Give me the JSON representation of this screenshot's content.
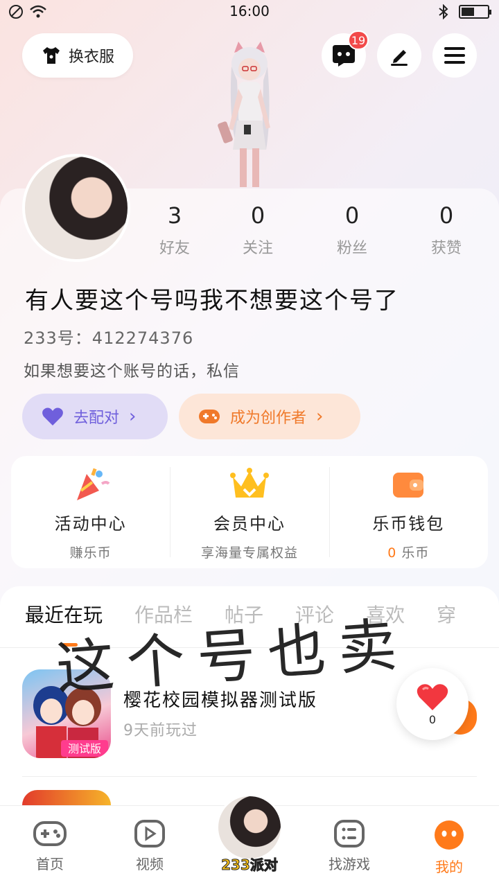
{
  "status_bar": {
    "time": "16:00"
  },
  "top": {
    "outfit_label": "换衣服",
    "message_badge": "19"
  },
  "profile": {
    "stats": [
      {
        "value": "3",
        "label": "好友"
      },
      {
        "value": "0",
        "label": "关注"
      },
      {
        "value": "0",
        "label": "粉丝"
      },
      {
        "value": "0",
        "label": "获赞"
      }
    ],
    "name": "有人要这个号吗我不想要这个号了",
    "uid": "233号：412274376",
    "bio": "如果想要这个账号的话，私信",
    "pair_button": "去配对",
    "creator_button": "成为创作者"
  },
  "services": [
    {
      "title": "活动中心",
      "subtitle": "赚乐币"
    },
    {
      "title": "会员中心",
      "subtitle": "享海量专属权益"
    },
    {
      "title": "乐币钱包",
      "subtitle_value": "0",
      "subtitle_unit": "乐币"
    }
  ],
  "tabs": [
    "最近在玩",
    "作品栏",
    "帖子",
    "评论",
    "喜欢",
    "穿"
  ],
  "overlay_text": "这个号也卖",
  "recent": {
    "title": "樱花校园模拟器测试版",
    "subtitle": "9天前玩过",
    "icon_badge": "测试版"
  },
  "like_count": "0",
  "nav": {
    "home": "首页",
    "video": "视频",
    "center": "233派对",
    "find": "找游戏",
    "mine": "我的"
  },
  "colors": {
    "accent": "#ff7a1a",
    "pair": "#6f5fdc",
    "badge": "#f24a4a"
  }
}
